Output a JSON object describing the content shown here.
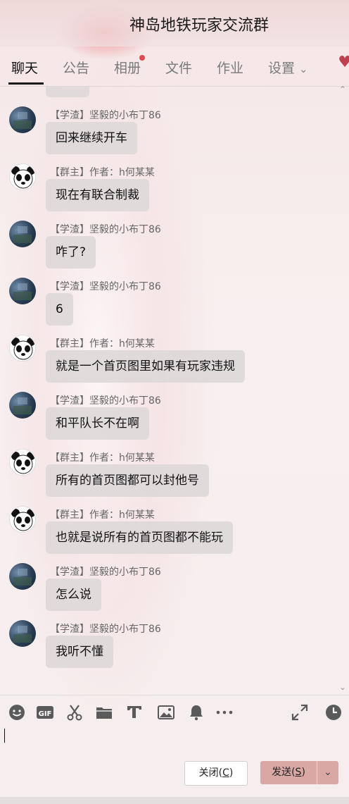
{
  "window": {
    "title": "神岛地铁玩家交流群"
  },
  "tabs": [
    {
      "label": "聊天",
      "active": true
    },
    {
      "label": "公告"
    },
    {
      "label": "相册",
      "badge": true
    },
    {
      "label": "文件"
    },
    {
      "label": "作业"
    },
    {
      "label": "设置",
      "dropdown": true
    }
  ],
  "messages": [
    {
      "sender": "【学渣】坚毅的小布丁86",
      "avatar": "student-avatar",
      "text": "回来继续开车"
    },
    {
      "sender": "【群主】作者：h何某某",
      "avatar": "panda-avatar",
      "text": "现在有联合制裁"
    },
    {
      "sender": "【学渣】坚毅的小布丁86",
      "avatar": "student-avatar",
      "text": "咋了?"
    },
    {
      "sender": "【学渣】坚毅的小布丁86",
      "avatar": "student-avatar",
      "text": "6"
    },
    {
      "sender": "【群主】作者：h何某某",
      "avatar": "panda-avatar",
      "text": "就是一个首页图里如果有玩家违规"
    },
    {
      "sender": "【学渣】坚毅的小布丁86",
      "avatar": "student-avatar",
      "text": "和平队长不在啊"
    },
    {
      "sender": "【群主】作者：h何某某",
      "avatar": "panda-avatar",
      "text": "所有的首页图都可以封他号"
    },
    {
      "sender": "【群主】作者：h何某某",
      "avatar": "panda-avatar",
      "text": "也就是说所有的首页图都不能玩"
    },
    {
      "sender": "【学渣】坚毅的小布丁86",
      "avatar": "student-avatar",
      "text": "怎么说"
    },
    {
      "sender": "【学渣】坚毅的小布丁86",
      "avatar": "student-avatar",
      "text": "我听不懂"
    }
  ],
  "toolbar": {
    "tools": [
      "emoji-icon",
      "gif-icon",
      "scissors-icon",
      "folder-icon",
      "font-icon",
      "image-icon",
      "bell-icon",
      "more-icon"
    ],
    "right_tools": [
      "expand-icon",
      "history-icon"
    ]
  },
  "input": {
    "value": ""
  },
  "buttons": {
    "close_label": "关闭(",
    "close_key": "C",
    "close_tail": ")",
    "send_label": "发送(",
    "send_key": "S",
    "send_tail": ")"
  },
  "colors": {
    "send_button": "#d9a8a5",
    "accent_red": "#e04a4a"
  }
}
